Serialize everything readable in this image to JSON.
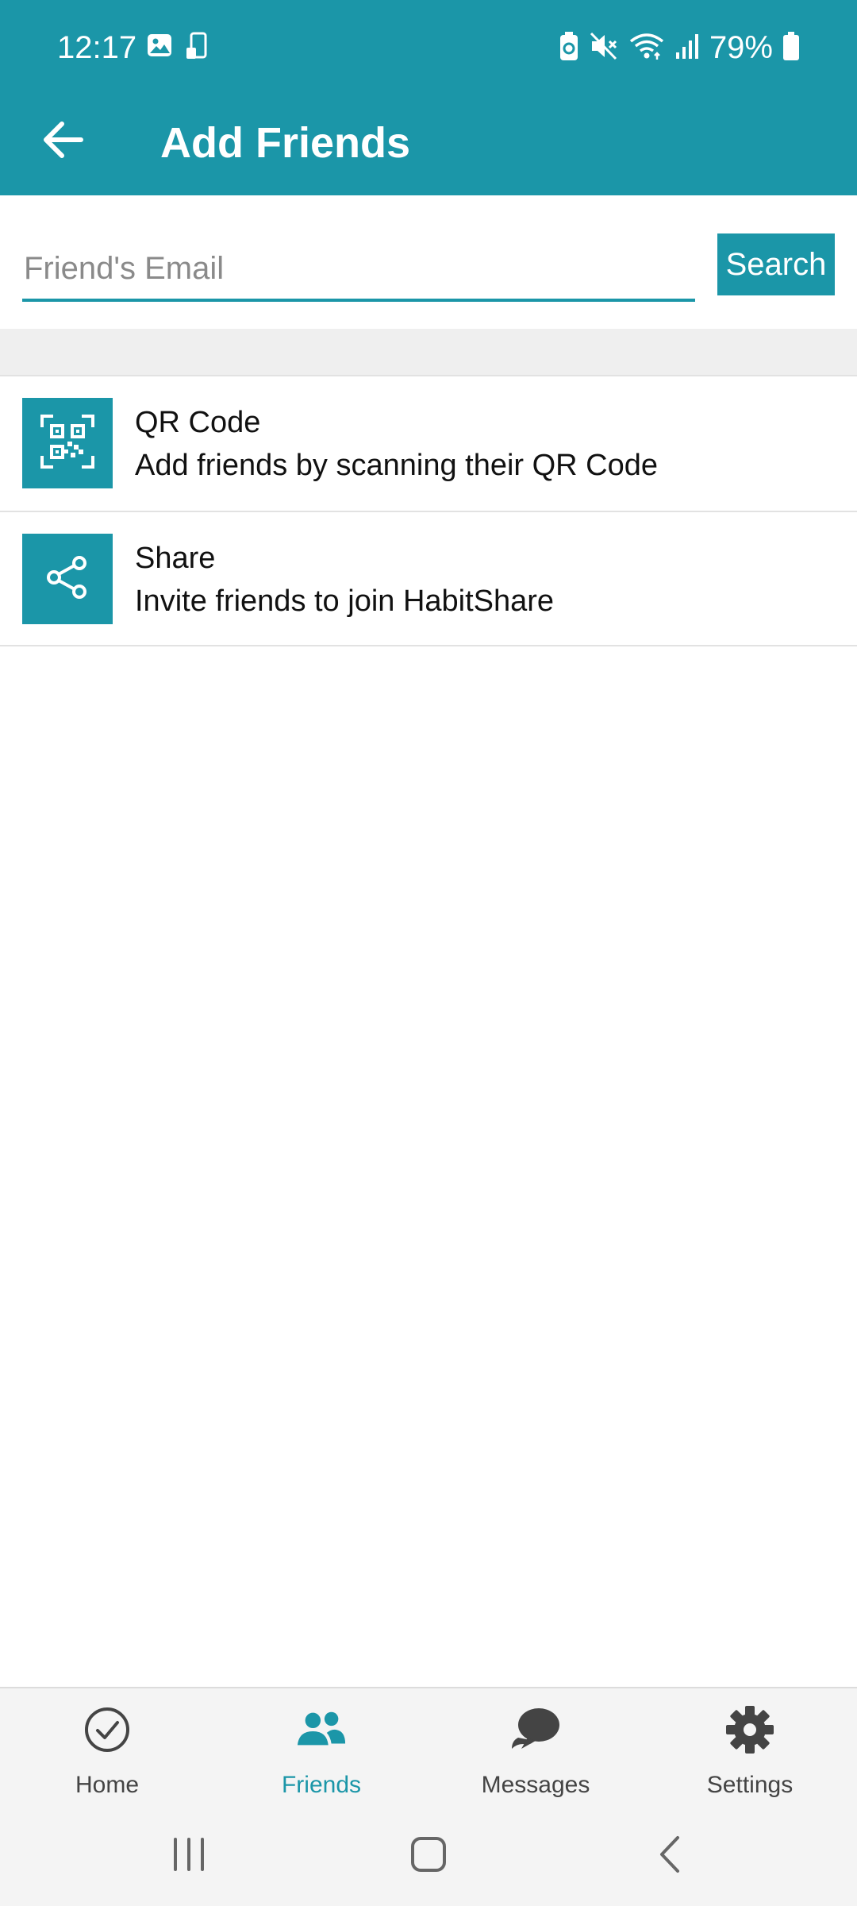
{
  "status_bar": {
    "time": "12:17",
    "battery_percent": "79%",
    "left_icons": [
      "gallery-icon",
      "phone-sync-icon"
    ],
    "right_icons": [
      "battery-saver-icon",
      "mute-icon",
      "wifi-icon",
      "signal-icon",
      "battery-icon"
    ]
  },
  "appbar": {
    "title": "Add Friends",
    "back_icon": "arrow-left-icon"
  },
  "search": {
    "placeholder": "Friend's Email",
    "value": "",
    "button_label": "Search"
  },
  "options": [
    {
      "icon": "qr-code-icon",
      "title": "QR Code",
      "subtitle": "Add friends by scanning their QR Code"
    },
    {
      "icon": "share-icon",
      "title": "Share",
      "subtitle": "Invite friends to join HabitShare"
    }
  ],
  "bottom_nav": {
    "active": "Friends",
    "items": [
      {
        "label": "Home",
        "icon": "check-circle-icon"
      },
      {
        "label": "Friends",
        "icon": "people-icon"
      },
      {
        "label": "Messages",
        "icon": "chat-bubbles-icon"
      },
      {
        "label": "Settings",
        "icon": "gear-icon"
      }
    ]
  },
  "colors": {
    "primary": "#1b96a8",
    "nav_inactive": "#444444",
    "divider_band": "#efefef"
  }
}
